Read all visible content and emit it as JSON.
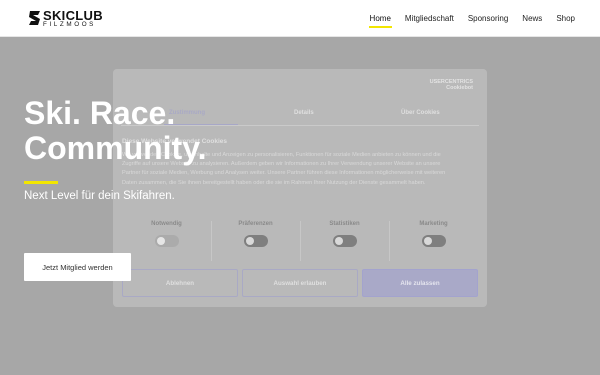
{
  "logo": {
    "line1": "SKICLUB",
    "line2": "FILZMOOS"
  },
  "nav": {
    "items": [
      "Home",
      "Mitgliedschaft",
      "Sponsoring",
      "News",
      "Shop"
    ],
    "active": "Home"
  },
  "hero": {
    "title_line1": "Ski. Race.",
    "title_line2": "Community.",
    "subtitle": "Next Level für dein Skifahren.",
    "cta": "Jetzt Mitglied werden"
  },
  "consent": {
    "brand_line1": "USERCENTRICS",
    "brand_line2": "Cookiebot",
    "tabs": [
      "Zustimmung",
      "Details",
      "Über Cookies"
    ],
    "heading": "Diese Website verwendet Cookies",
    "body": "Wir verwenden Cookies, um Inhalte und Anzeigen zu personalisieren, Funktionen für soziale Medien anbieten zu können und die Zugriffe auf unsere Website zu analysieren. Außerdem geben wir Informationen zu Ihrer Verwendung unserer Website an unsere Partner für soziale Medien, Werbung und Analysen weiter. Unsere Partner führen diese Informationen möglicherweise mit weiteren Daten zusammen, die Sie ihnen bereitgestellt haben oder die sie im Rahmen Ihrer Nutzung der Dienste gesammelt haben.",
    "toggles": [
      "Notwendig",
      "Präferenzen",
      "Statistiken",
      "Marketing"
    ],
    "buttons": {
      "deny": "Ablehnen",
      "allow_selection": "Auswahl erlauben",
      "allow_all": "Alle zulassen"
    }
  },
  "colors": {
    "accent": "#f2e600",
    "overlay": "#a7a7a7"
  }
}
